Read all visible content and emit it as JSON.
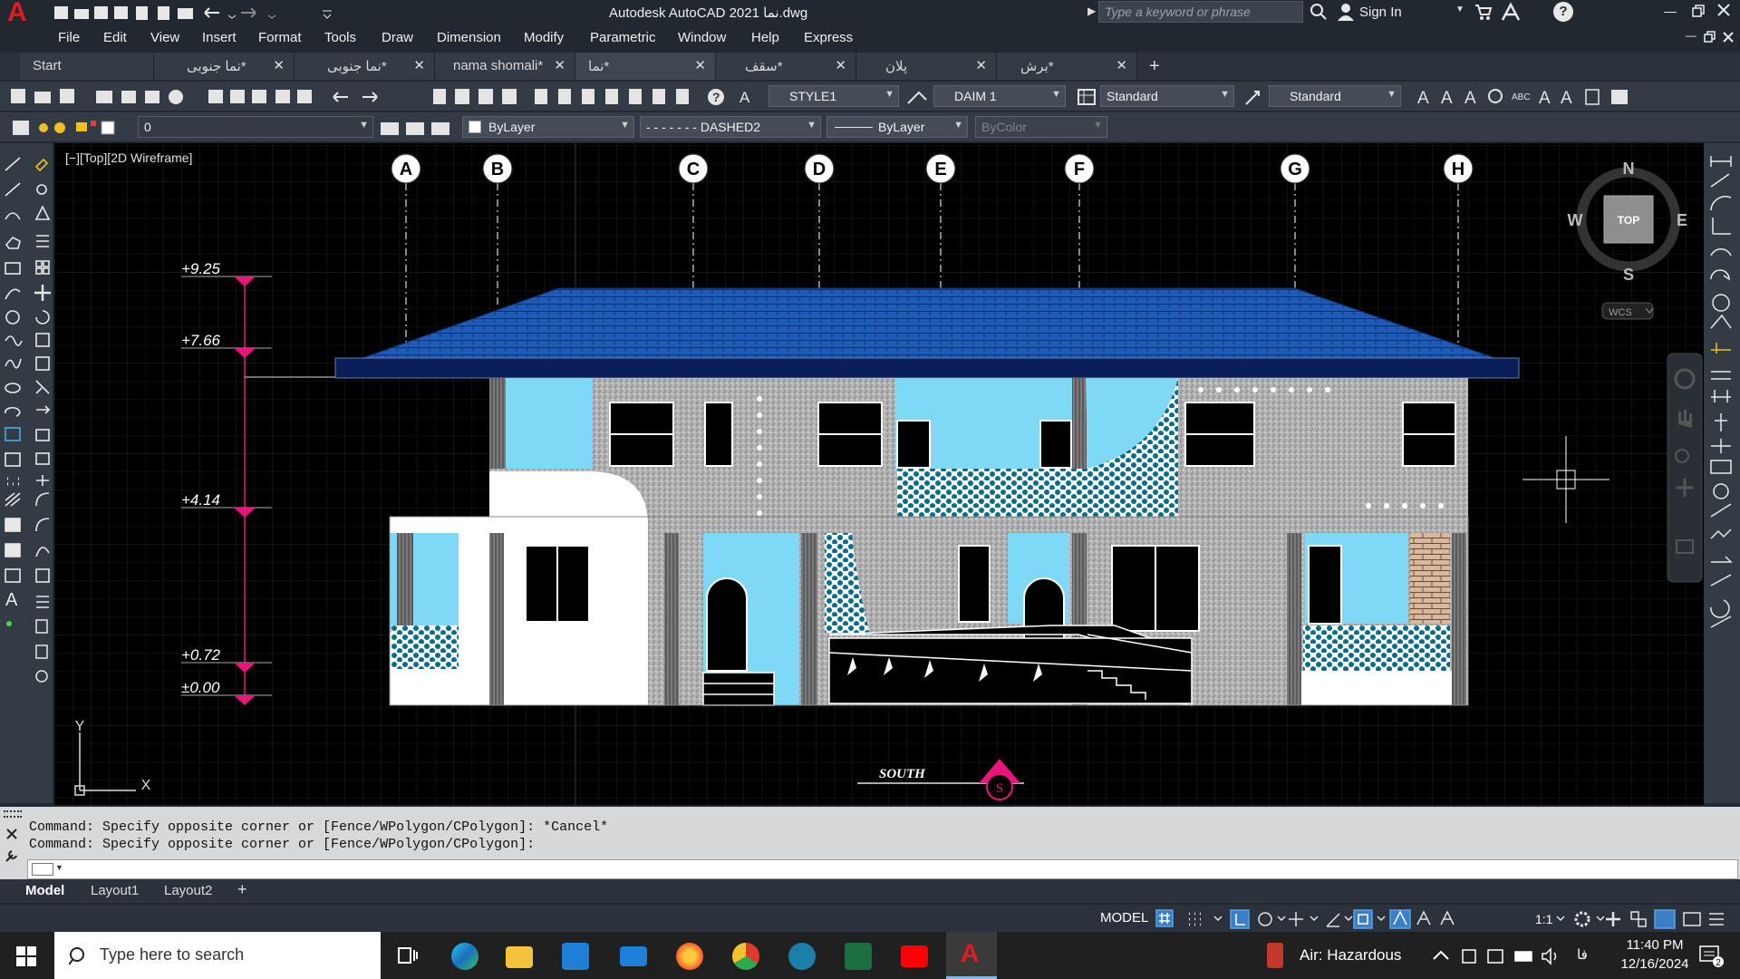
{
  "window": {
    "title": "Autodesk AutoCAD 2021  نما.dwg",
    "search_placeholder": "Type a keyword or phrase",
    "sign_in": "Sign In",
    "app_logo": "A"
  },
  "menu": [
    "File",
    "Edit",
    "View",
    "Insert",
    "Format",
    "Tools",
    "Draw",
    "Dimension",
    "Modify",
    "Parametric",
    "Window",
    "Help",
    "Express"
  ],
  "tabs": [
    {
      "label": "Start"
    },
    {
      "label": "نما جنوبی*"
    },
    {
      "label": "نما جنوبی*"
    },
    {
      "label": "nama shomali*"
    },
    {
      "label": "نما*"
    },
    {
      "label": "سقف*"
    },
    {
      "label": "پلان"
    },
    {
      "label": "برش*"
    }
  ],
  "toolbar": {
    "text_style": "STYLE1",
    "dim_style": "DAIM 1",
    "table_style": "Standard",
    "multileader_style": "Standard",
    "layer": "0",
    "color": "ByLayer",
    "linetype": "- - - - - - -  DASHED2",
    "lineweight": "ByLayer",
    "plotstyle": "ByColor"
  },
  "viewport": {
    "label": "[−][Top][2D Wireframe]",
    "grid_labels": [
      "A",
      "B",
      "C",
      "D",
      "E",
      "F",
      "G",
      "H"
    ],
    "levels": [
      "+9.25",
      "+7.66",
      "+4.14",
      "+0.72",
      "±0.00"
    ],
    "south_label": "SOUTH",
    "south_marker": "S",
    "ucs_y": "Y",
    "ucs_x": "X",
    "viewcube": {
      "n": "N",
      "s": "S",
      "e": "E",
      "w": "W",
      "top": "TOP",
      "wcs": "WCS"
    }
  },
  "colors": {
    "roof": "#1f5bb5",
    "glass": "#7fd8f5",
    "wall": "#bcbcbc",
    "accent": "#e9157a",
    "app": "#c4151c"
  },
  "command": {
    "line1": "Command: Specify opposite corner or [Fence/WPolygon/CPolygon]: *Cancel*",
    "line2": "Command: Specify opposite corner or [Fence/WPolygon/CPolygon]:"
  },
  "layout_tabs": [
    "Model",
    "Layout1",
    "Layout2"
  ],
  "status": {
    "model": "MODEL",
    "scale": "1:1"
  },
  "taskbar": {
    "search_placeholder": "Type here to search",
    "weather": "Air: Hazardous",
    "lang": "فا",
    "time": "11:40 PM",
    "date": "12/16/2024"
  }
}
